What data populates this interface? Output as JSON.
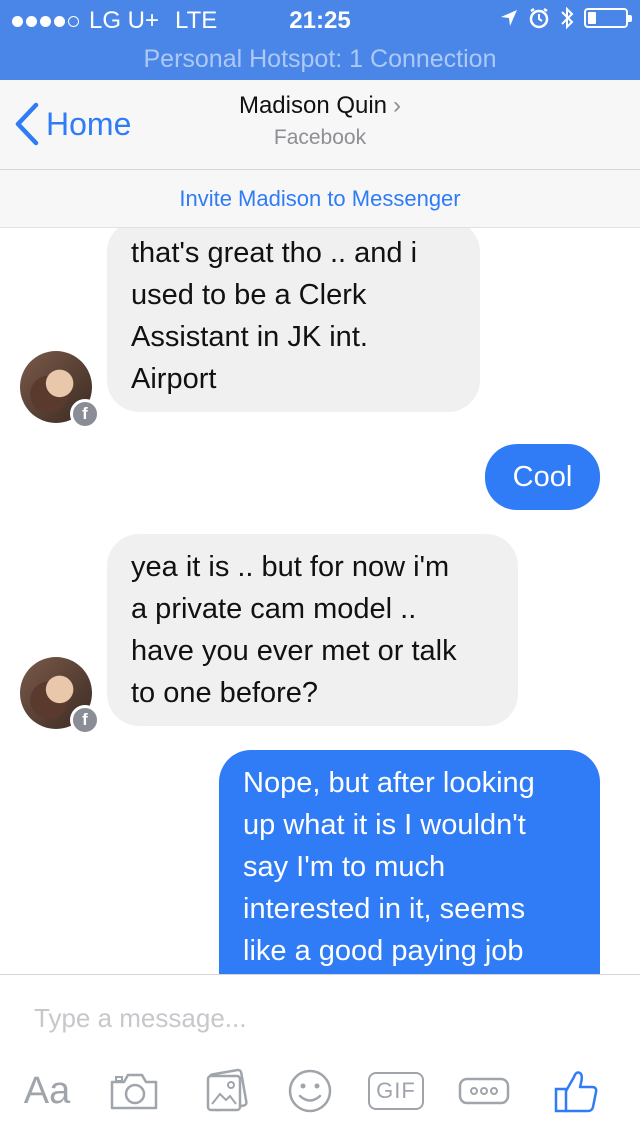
{
  "status_bar": {
    "carrier": "LG U+",
    "network": "LTE",
    "time": "21:25",
    "signal_bars": 4,
    "signal_total": 5,
    "battery_level": 0.15
  },
  "hotspot": {
    "text": "Personal Hotspot: 1 Connection"
  },
  "nav": {
    "back_label": "Home",
    "title": "Madison Quin",
    "subtitle": "Facebook",
    "chevron": "›"
  },
  "invite": {
    "label": "Invite Madison to Messenger"
  },
  "messages": [
    {
      "side": "in",
      "lines": [
        "that's great tho .. and i",
        "used to be a Clerk",
        "Assistant in JK int.",
        "Airport"
      ]
    },
    {
      "side": "out",
      "lines": [
        "Cool"
      ]
    },
    {
      "side": "in",
      "lines": [
        "yea it is .. but for now i'm",
        "a private cam model ..",
        "have you ever met or talk",
        "to one before?"
      ]
    },
    {
      "side": "out",
      "lines": [
        "Nope, but after looking",
        "up what it is I wouldn't",
        "say I'm to much",
        "interested in it, seems",
        "like a good paying job"
      ]
    }
  ],
  "avatar_badge": "f",
  "composer": {
    "placeholder": "Type a message...",
    "text_tool": "Aa",
    "gif_label": "GIF"
  },
  "icons": {
    "back": "chevron-left-icon",
    "camera": "camera-icon",
    "gallery": "photo-gallery-icon",
    "emoji": "smiley-icon",
    "gif": "gif-icon",
    "more": "more-icon",
    "like": "thumbs-up-icon"
  },
  "colors": {
    "header_blue": "#4a86e8",
    "accent": "#2f7cf6",
    "incoming_bubble": "#f0f0f0",
    "tool_gray": "#a0a4ab"
  }
}
